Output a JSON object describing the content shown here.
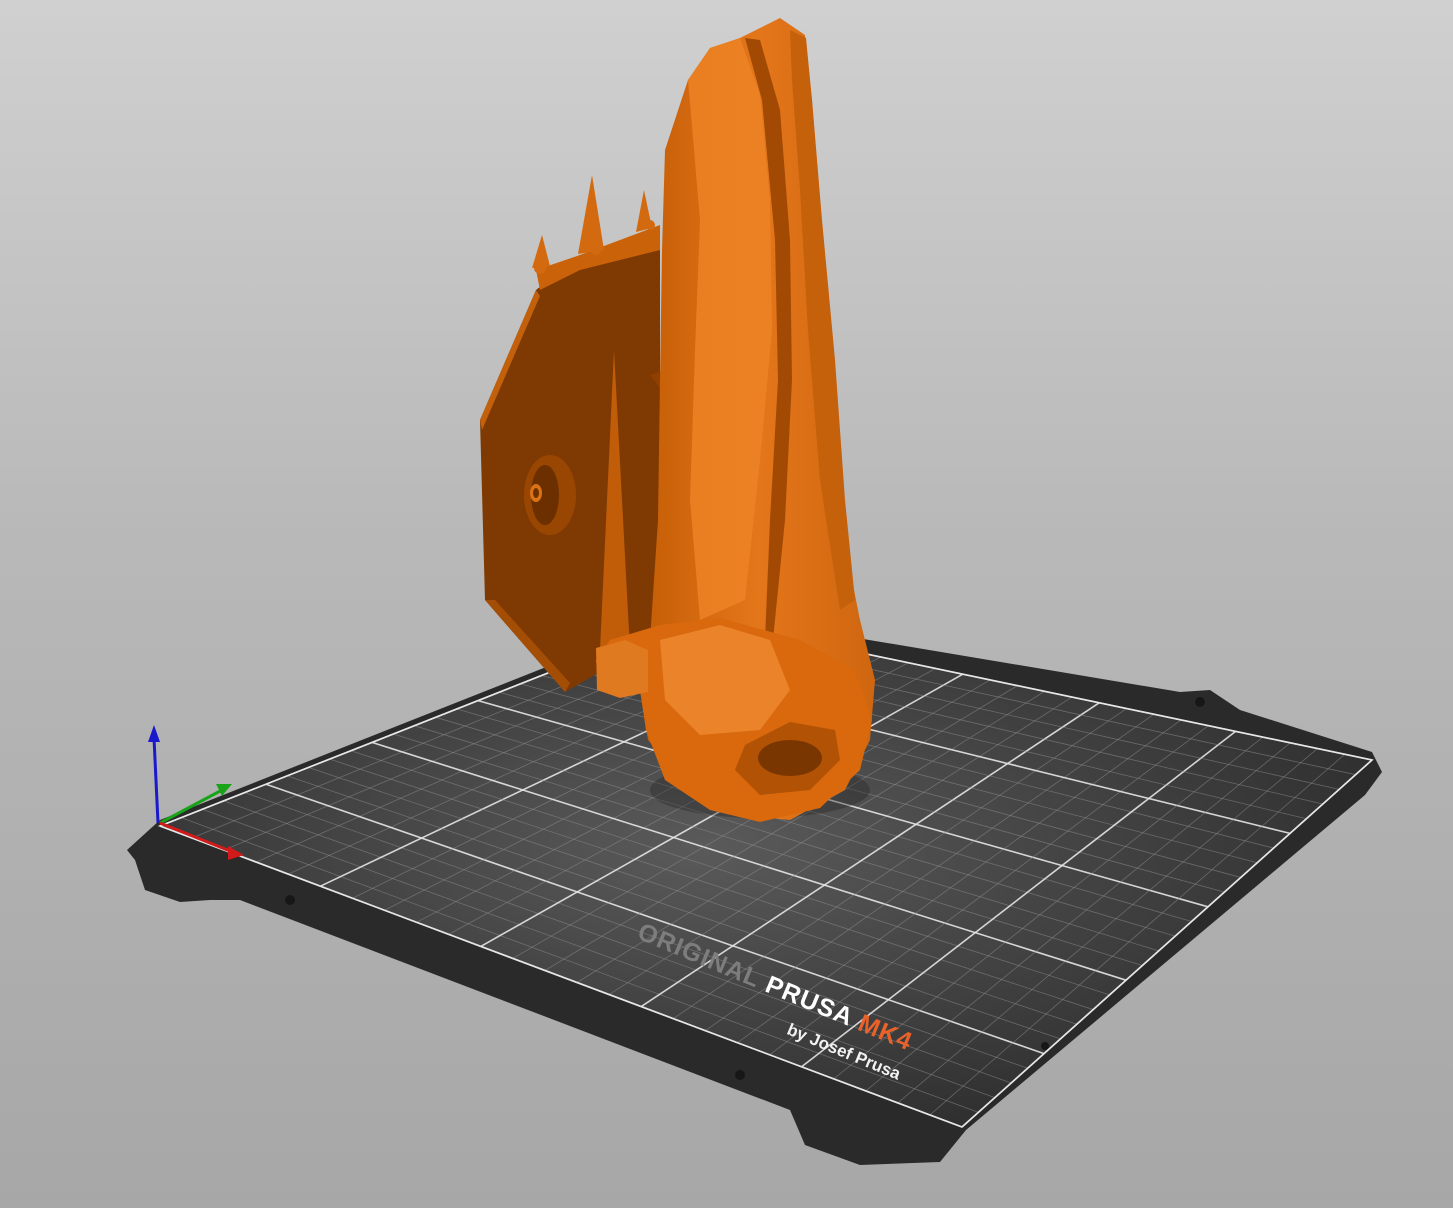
{
  "viewport": {
    "bed": {
      "brand_prefix": "ORIGINAL",
      "brand_name": "PRUSA",
      "model": "MK4",
      "tagline": "by Josef Prusa",
      "colors": {
        "sheet": "#2b2b2b",
        "grid_minor": "#8f8f8f",
        "grid_major": "#e6e6e6",
        "brand_text": "#ffffff",
        "prefix_text": "#7d7d7d",
        "model_text": "#e8622a"
      }
    },
    "model": {
      "colors": {
        "base": "#d8680a",
        "shadow": "#8a3c00",
        "light": "#f28a2c",
        "mid": "#b45306"
      }
    },
    "axes": {
      "x_color": "#d11a1a",
      "y_color": "#19a319",
      "z_color": "#1a1acc"
    }
  }
}
